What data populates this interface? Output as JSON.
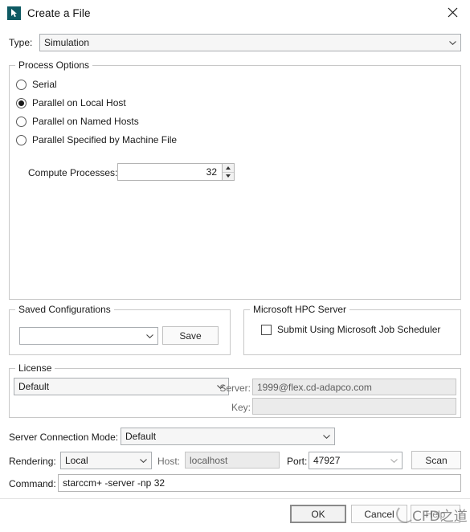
{
  "window": {
    "title": "Create a File",
    "icon": "starccm-app-icon",
    "close_label": "✕"
  },
  "type_row": {
    "label": "Type:",
    "value": "Simulation"
  },
  "process_options": {
    "legend": "Process Options",
    "radios": [
      {
        "label": "Serial",
        "checked": false
      },
      {
        "label": "Parallel on Local Host",
        "checked": true
      },
      {
        "label": "Parallel on Named Hosts",
        "checked": false
      },
      {
        "label": "Parallel Specified by Machine File",
        "checked": false
      }
    ],
    "compute_processes": {
      "label": "Compute Processes:",
      "value": "32"
    }
  },
  "saved_configurations": {
    "legend": "Saved Configurations",
    "combo_value": "",
    "save_label": "Save"
  },
  "hpc": {
    "legend": "Microsoft HPC Server",
    "checkbox_label": "Submit Using Microsoft Job Scheduler",
    "checked": false
  },
  "license": {
    "legend": "License",
    "combo_value": "Default",
    "server_label": "Server:",
    "server_value": "1999@flex.cd-adapco.com",
    "key_label": "Key:",
    "key_value": ""
  },
  "server_connection": {
    "label": "Server Connection Mode:",
    "value": "Default"
  },
  "rendering": {
    "label": "Rendering:",
    "value": "Local",
    "host_label": "Host:",
    "host_value": "localhost",
    "port_label": "Port:",
    "port_value": "47927",
    "scan_label": "Scan"
  },
  "command": {
    "label": "Command:",
    "value": "starccm+ -server -np 32"
  },
  "footer": {
    "ok_label": "OK",
    "cancel_label": "Cancel",
    "help_label": "Help"
  },
  "watermark": {
    "text": "CFD之道"
  },
  "colors": {
    "app_icon_bg": "#0e5a63",
    "group_border": "#c8c8c8",
    "disabled_field": "#ebebeb"
  }
}
